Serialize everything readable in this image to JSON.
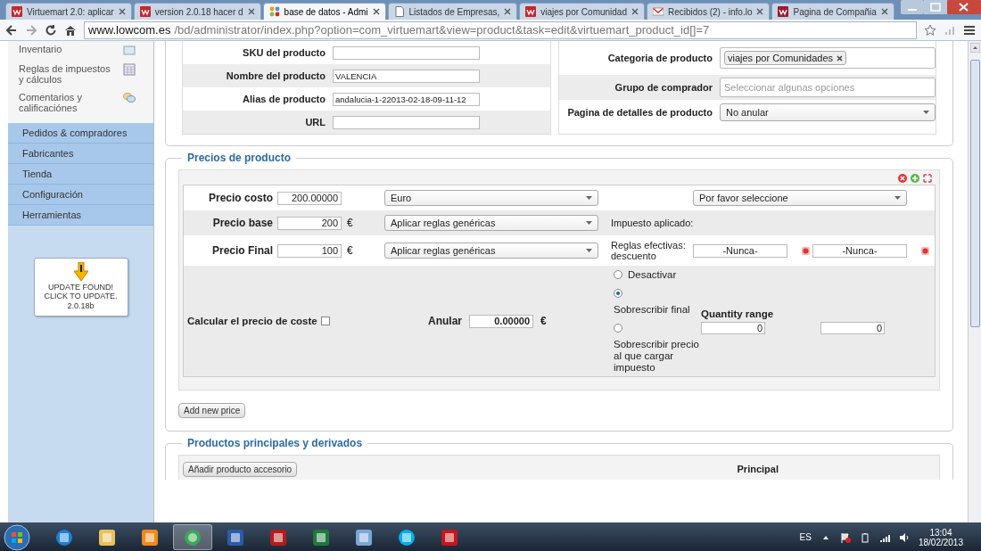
{
  "browser": {
    "tabs": [
      {
        "title": "Virtuemart 2.0: aplicar",
        "kind": "vm",
        "selected": false
      },
      {
        "title": "version 2.0.18 hacer d",
        "kind": "vm",
        "selected": false
      },
      {
        "title": "base de datos - Admi",
        "kind": "joomla",
        "selected": true
      },
      {
        "title": "Listados de Empresas,",
        "kind": "page",
        "selected": false
      },
      {
        "title": "viajes por Comunidad",
        "kind": "vm",
        "selected": false
      },
      {
        "title": "Recibidos (2) - info.lo",
        "kind": "mail",
        "selected": false
      },
      {
        "title": "Pagina de Compañia",
        "kind": "brand",
        "selected": false
      }
    ],
    "url_host": "www.lowcom.es",
    "url_path": "/bd/administrator/index.php?option=com_virtuemart&view=product&task=edit&virtuemart_product_id[]=7"
  },
  "sidebar": {
    "items": [
      {
        "label": "Inventario",
        "kind": "box"
      },
      {
        "label": "Reglas de impuestos y cálculos",
        "kind": "calendar"
      },
      {
        "label": "Comentarios y calificaciónes",
        "kind": "chat"
      }
    ],
    "nav": [
      "Pedidos & compradores",
      "Fabricantes",
      "Tienda",
      "Configuración",
      "Herramientas"
    ],
    "update": {
      "text": "UPDATE FOUND! CLICK TO UPDATE.",
      "version": "2.0.18b"
    }
  },
  "product": {
    "fields": [
      {
        "label": "SKU del producto"
      },
      {
        "label": "Nombre del producto",
        "value": "VALENCIA"
      },
      {
        "label": "Alias de producto",
        "value": "andalucia-1-22013-02-18-09-11-12"
      },
      {
        "label": "URL"
      }
    ],
    "category": {
      "label": "Categoria de producto",
      "tag": "viajes por Comunidades"
    },
    "group": {
      "label": "Grupo de comprador",
      "placeholder": "Seleccionar algunas opciones"
    },
    "detail_page": {
      "label": "Pagina de detalles de producto",
      "value": "No anular"
    }
  },
  "prices": {
    "legend": "Precios de producto",
    "cost": {
      "label": "Precio costo",
      "value": "200.00000",
      "currency": "Euro",
      "select": "Por favor seleccione"
    },
    "base": {
      "label": "Precio base",
      "value": "200",
      "unit": "€",
      "select": "Aplicar reglas genéricas",
      "note": "Impuesto aplicado:"
    },
    "final": {
      "label": "Precio Final",
      "value": "100",
      "unit": "€",
      "select": "Aplicar reglas genéricas",
      "note": "Reglas efectivas: descuento",
      "dates": [
        "-Nunca-",
        "-Nunca-"
      ]
    },
    "calc": {
      "label": "Calcular el precio de coste",
      "checked": false
    },
    "override": {
      "label": "Anular",
      "value": "0.00000",
      "unit": "€"
    },
    "radios": [
      {
        "label": "Desactivar",
        "selected": false
      },
      {
        "label": "Sobrescribir final",
        "selected": true
      },
      {
        "label": "Sobrescribir precio al que cargar impuesto",
        "selected": false
      }
    ],
    "quantity": {
      "label": "Quantity range",
      "from": "0",
      "to": "0"
    },
    "add_button": "Add new price"
  },
  "related": {
    "legend": "Productos principales y derivados",
    "button": "Añadir producto accesorio",
    "column": "Principal"
  },
  "taskbar": {
    "apps": [
      {
        "kind": "ie",
        "selected": false
      },
      {
        "kind": "folder",
        "selected": false
      },
      {
        "kind": "media",
        "selected": false
      },
      {
        "kind": "chrome",
        "selected": true
      },
      {
        "kind": "word",
        "selected": false
      },
      {
        "kind": "filezilla",
        "selected": false
      },
      {
        "kind": "excel",
        "selected": false
      },
      {
        "kind": "notes",
        "selected": false
      },
      {
        "kind": "skype",
        "selected": false
      },
      {
        "kind": "acrobat",
        "selected": false
      }
    ],
    "lang": "ES",
    "time": "13:04",
    "date": "18/02/2013"
  }
}
